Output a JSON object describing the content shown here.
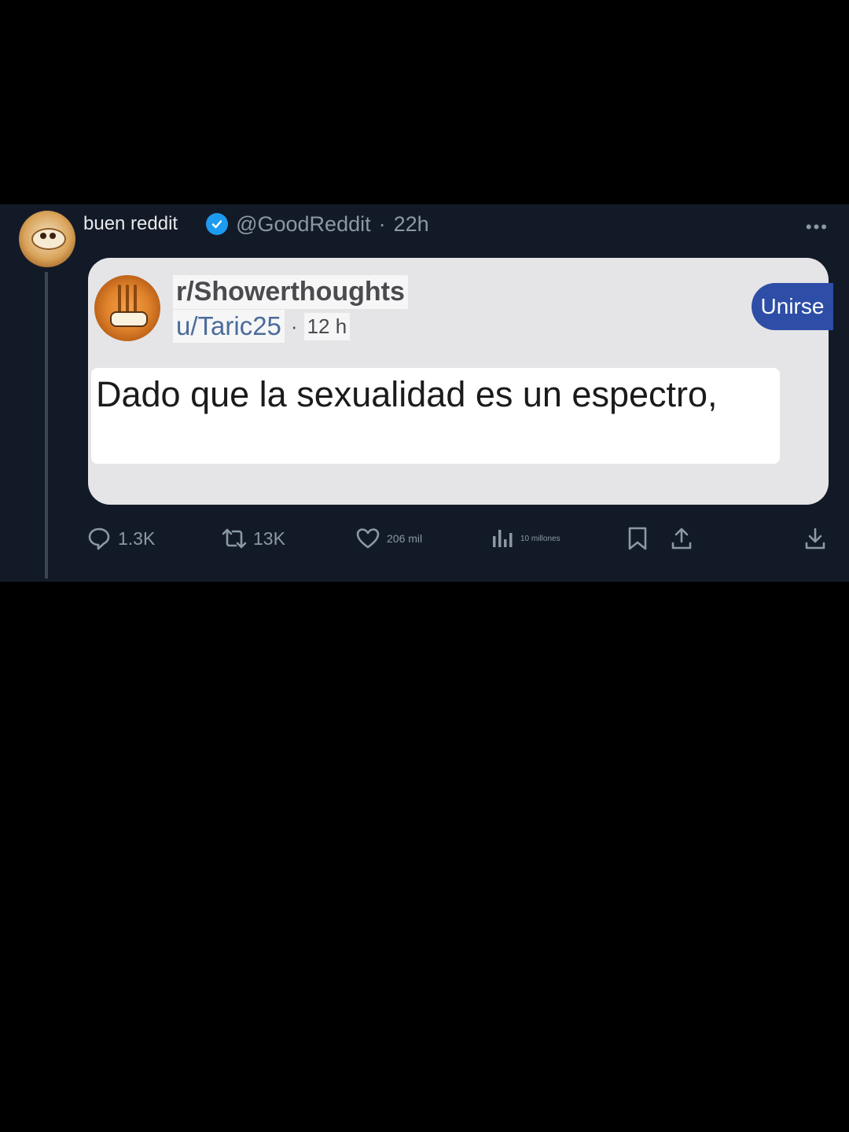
{
  "tweet": {
    "display_name": "buen reddit",
    "handle": "@GoodReddit",
    "separator": "·",
    "time": "22h",
    "more_label": "•••"
  },
  "embed": {
    "subreddit": "r/Showerthoughts",
    "username": "u/Taric25",
    "separator": "·",
    "time": "12 h",
    "join_label": "Unirse",
    "post_text": "Dado que la sexualidad es un espectro,"
  },
  "actions": {
    "replies": "1.3K",
    "retweets": "13K",
    "likes": "206 mil",
    "views": "10 millones"
  },
  "colors": {
    "background": "#131a27",
    "verified": "#1d9bf0",
    "join_button": "#2d4da6"
  },
  "icons": [
    "reply-icon",
    "retweet-icon",
    "like-icon",
    "views-icon",
    "bookmark-icon",
    "share-icon",
    "download-icon",
    "verified-icon",
    "more-icon"
  ]
}
